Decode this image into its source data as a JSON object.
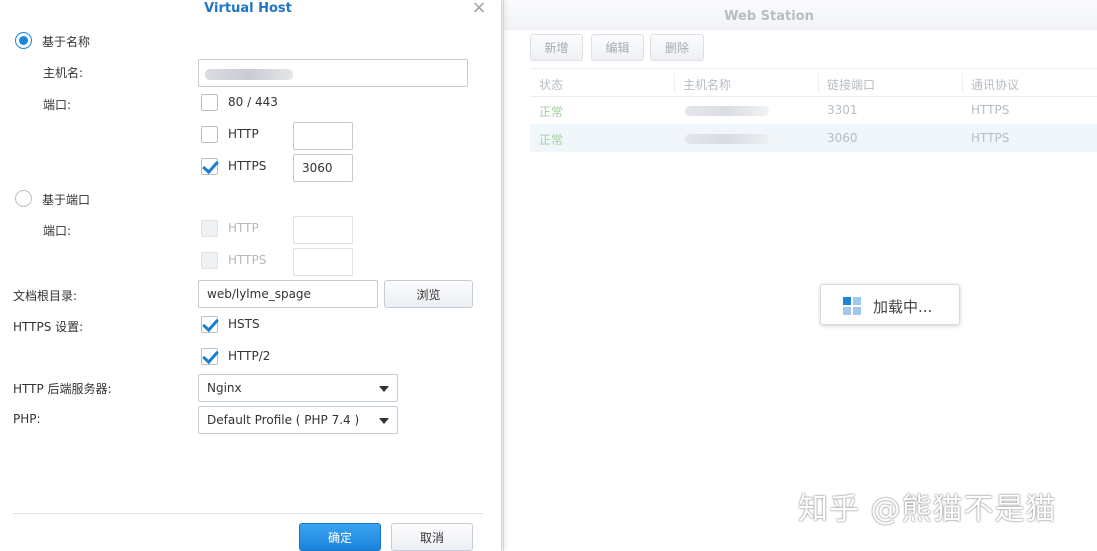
{
  "web_station": {
    "title": "Web Station",
    "toolbar": {
      "add": "新增",
      "edit": "编辑",
      "delete": "删除"
    },
    "columns": [
      "状态",
      "主机名称",
      "链接端口",
      "通讯协议"
    ],
    "rows": [
      {
        "status": "正常",
        "port": "3301",
        "protocol": "HTTPS"
      },
      {
        "status": "正常",
        "port": "3060",
        "protocol": "HTTPS"
      }
    ],
    "loading_text": "加载中..."
  },
  "watermark": "知乎 @熊猫不是猫",
  "dialog": {
    "title": "Virtual Host",
    "by_name": {
      "label": "基于名称",
      "selected": true,
      "hostname_label": "主机名:",
      "port_label": "端口:",
      "port_options": [
        {
          "label": "80 / 443",
          "checked": false
        },
        {
          "label": "HTTP",
          "checked": false,
          "value": ""
        },
        {
          "label": "HTTPS",
          "checked": true,
          "value": "3060"
        }
      ]
    },
    "by_port": {
      "label": "基于端口",
      "selected": false,
      "port_label": "端口:",
      "port_options": [
        {
          "label": "HTTP",
          "checked": false,
          "value": ""
        },
        {
          "label": "HTTPS",
          "checked": false,
          "value": ""
        }
      ]
    },
    "docroot": {
      "label": "文档根目录:",
      "value": "web/lylme_spage",
      "browse": "浏览"
    },
    "https_settings": {
      "label": "HTTPS 设置:",
      "options": [
        {
          "label": "HSTS",
          "checked": true
        },
        {
          "label": "HTTP/2",
          "checked": true
        }
      ]
    },
    "backend": {
      "label": "HTTP 后端服务器:",
      "value": "Nginx"
    },
    "php": {
      "label": "PHP:",
      "value": "Default Profile ( PHP 7.4 )"
    },
    "ok": "确定",
    "cancel": "取消"
  },
  "colors": {
    "accent": "#1b84db",
    "status_ok": "#9dd39a",
    "title_blue": "#1e74c5"
  }
}
